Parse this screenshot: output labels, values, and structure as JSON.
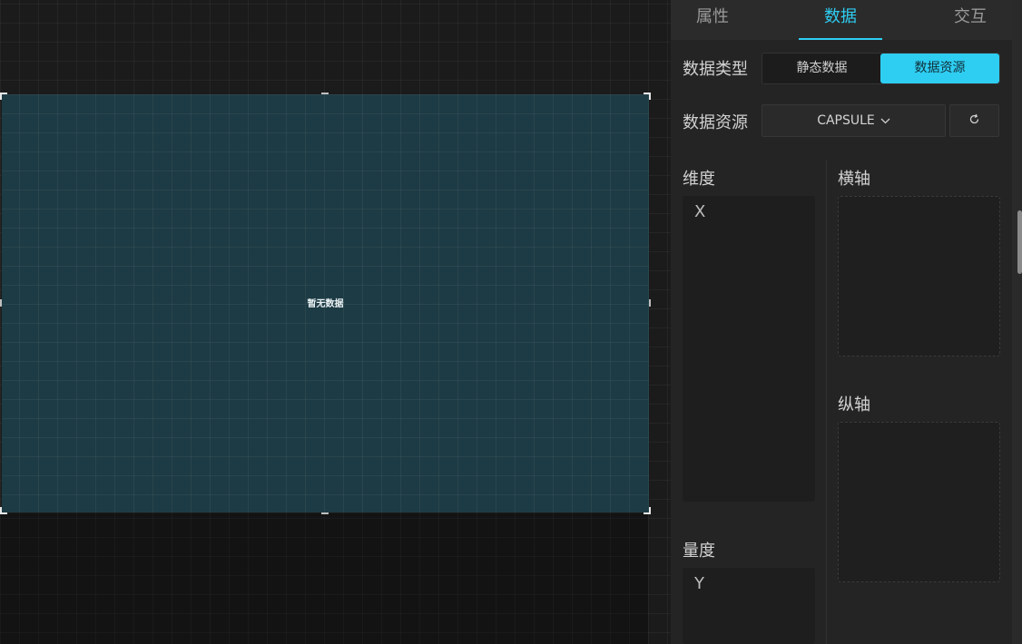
{
  "canvas": {
    "widget": {
      "empty_text": "暂无数据"
    }
  },
  "panel": {
    "tabs": [
      {
        "label": "属性"
      },
      {
        "label": "数据"
      },
      {
        "label": "交互"
      }
    ],
    "active_tab": "数据",
    "data_type": {
      "label": "数据类型",
      "options": [
        "静态数据",
        "数据资源"
      ],
      "selected": "数据资源"
    },
    "data_source": {
      "label": "数据资源",
      "selected": "CAPSULE",
      "chevron_icon": "chevron-down-icon",
      "refresh_icon": "refresh-icon"
    },
    "dimension": {
      "label": "维度",
      "fields": [
        "X"
      ]
    },
    "measure": {
      "label": "量度",
      "fields": [
        "Y"
      ]
    },
    "x_axis": {
      "label": "横轴"
    },
    "y_axis": {
      "label": "纵轴"
    }
  },
  "colors": {
    "accent": "#2ecdf2",
    "widget_bg": "#1d3b44",
    "panel_bg": "#242424"
  }
}
